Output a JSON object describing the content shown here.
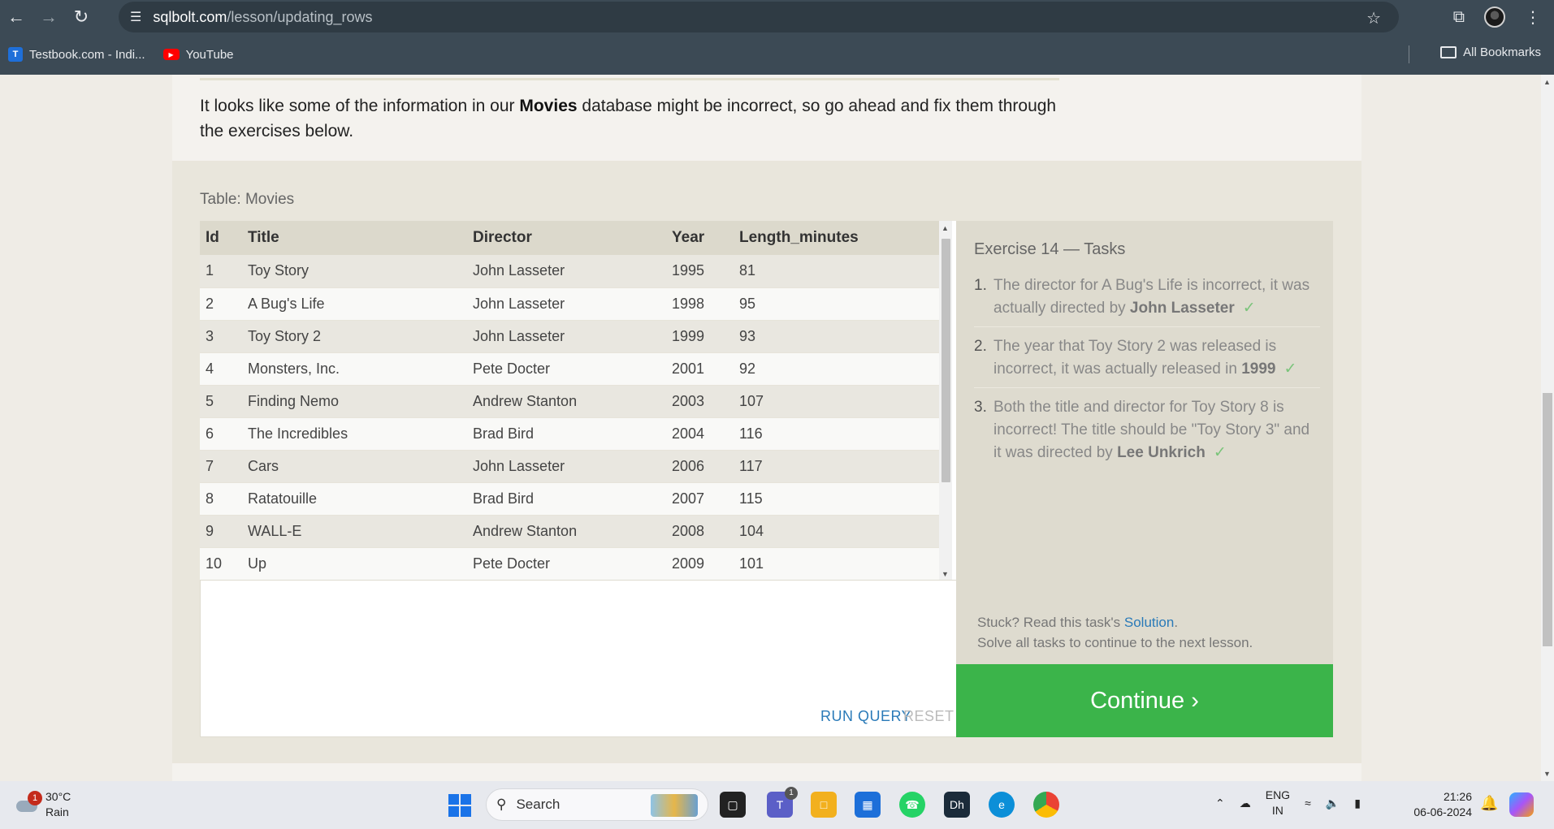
{
  "browser": {
    "url_host": "sqlbolt.com",
    "url_path": "/lesson/updating_rows",
    "bookmarks": [
      {
        "label": "Testbook.com - Indi...",
        "icon": "testbook-icon"
      },
      {
        "label": "YouTube",
        "icon": "youtube-icon"
      }
    ],
    "all_bookmarks_label": "All Bookmarks"
  },
  "lesson": {
    "intro_before": "It looks like some of the information in our ",
    "intro_bold": "Movies",
    "intro_after": " database might be incorrect, so go ahead and fix them through the exercises below.",
    "table_label": "Table: Movies",
    "table": {
      "columns": [
        "Id",
        "Title",
        "Director",
        "Year",
        "Length_minutes"
      ],
      "rows": [
        [
          "1",
          "Toy Story",
          "John Lasseter",
          "1995",
          "81"
        ],
        [
          "2",
          "A Bug's Life",
          "John Lasseter",
          "1998",
          "95"
        ],
        [
          "3",
          "Toy Story 2",
          "John Lasseter",
          "1999",
          "93"
        ],
        [
          "4",
          "Monsters, Inc.",
          "Pete Docter",
          "2001",
          "92"
        ],
        [
          "5",
          "Finding Nemo",
          "Andrew Stanton",
          "2003",
          "107"
        ],
        [
          "6",
          "The Incredibles",
          "Brad Bird",
          "2004",
          "116"
        ],
        [
          "7",
          "Cars",
          "John Lasseter",
          "2006",
          "117"
        ],
        [
          "8",
          "Ratatouille",
          "Brad Bird",
          "2007",
          "115"
        ],
        [
          "9",
          "WALL-E",
          "Andrew Stanton",
          "2008",
          "104"
        ],
        [
          "10",
          "Up",
          "Pete Docter",
          "2009",
          "101"
        ]
      ]
    },
    "run_query_label": "RUN QUERY",
    "reset_label": "RESET"
  },
  "tasks": {
    "title": "Exercise 14 — Tasks",
    "items": [
      {
        "num": "1.",
        "text": "The director for A Bug's Life is incorrect, it was actually directed by ",
        "bold": "John Lasseter",
        "check": "✓"
      },
      {
        "num": "2.",
        "text": "The year that Toy Story 2 was released is incorrect, it was actually released in ",
        "bold": "1999",
        "check": "✓"
      },
      {
        "num": "3.",
        "text": "Both the title and director for Toy Story 8 is incorrect! The title should be \"Toy Story 3\" and it was directed by ",
        "bold": "Lee Unkrich",
        "check": "✓"
      }
    ],
    "stuck_prefix": "Stuck? Read this task's ",
    "stuck_link": "Solution",
    "stuck_suffix": ".",
    "solve_all": "Solve all tasks to continue to the next lesson.",
    "continue_label": "Continue ›"
  },
  "taskbar": {
    "weather_temp": "30°C",
    "weather_desc": "Rain",
    "weather_badge": "1",
    "search_label": "Search",
    "teams_badge": "1",
    "lang_line1": "ENG",
    "lang_line2": "IN",
    "time": "21:26",
    "date": "06-06-2024"
  },
  "colors": {
    "continue_green": "#3bb44a",
    "link_blue": "#2a7ab8",
    "chrome_bar": "#3c4a55"
  }
}
